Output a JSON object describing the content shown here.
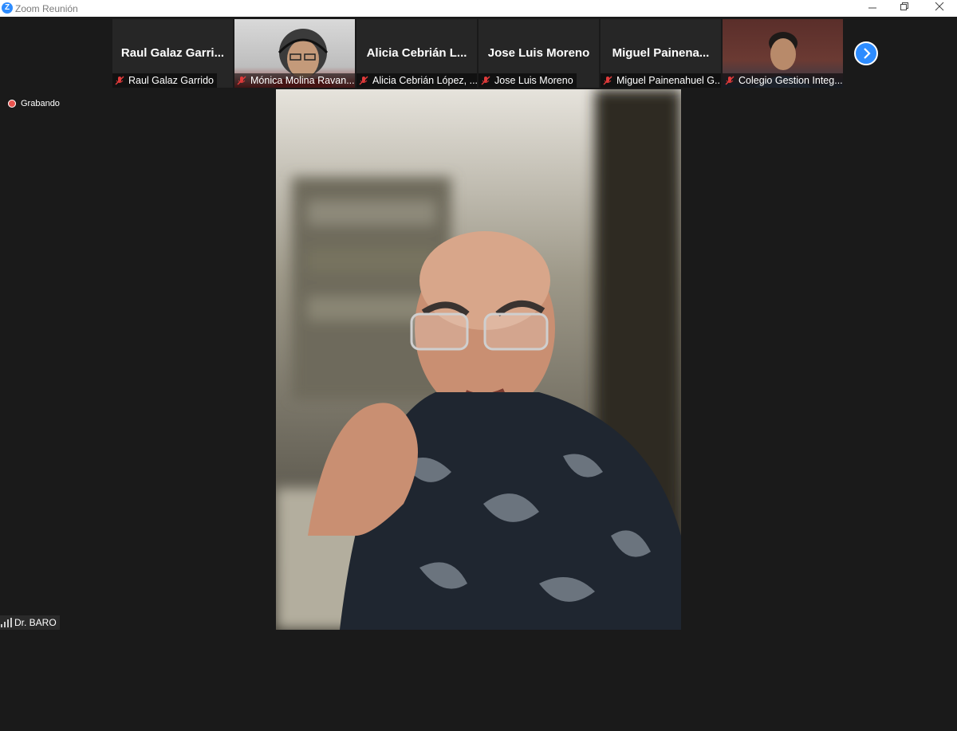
{
  "window": {
    "title": "Zoom Reunión",
    "logo_letter": "Z"
  },
  "recording": {
    "label": "Grabando"
  },
  "filmstrip": {
    "tiles": [
      {
        "display_name": "Raul  Galaz  Garri...",
        "label": "Raul Galaz Garrido",
        "has_video": false
      },
      {
        "display_name": "",
        "label": "Mónica Molina Ravan...",
        "has_video": true
      },
      {
        "display_name": "Alicia  Cebrián  L...",
        "label": "Alicia Cebrián López, ...",
        "has_video": false
      },
      {
        "display_name": "Jose Luis Moreno",
        "label": "Jose Luis Moreno",
        "has_video": false
      },
      {
        "display_name": "Miguel  Painena...",
        "label": "Miguel Painenahuel G...",
        "has_video": false
      },
      {
        "display_name": "",
        "label": "Colegio Gestion Integ...",
        "has_video": true
      }
    ],
    "next_icon": "chevron-right-icon"
  },
  "active_speaker": {
    "name": "Dr. BARO"
  },
  "colors": {
    "accent": "#2d8cff",
    "background": "#1a1a1a",
    "muted": "#e03a3a",
    "recording": "#e8534e"
  }
}
